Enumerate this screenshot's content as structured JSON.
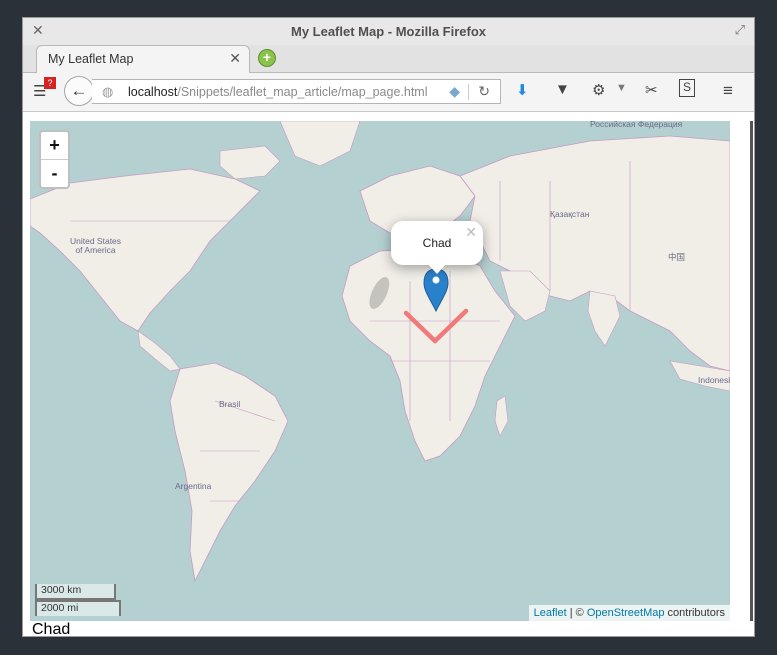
{
  "window": {
    "title": "My Leaflet Map - Mozilla Firefox"
  },
  "tab": {
    "label": "My Leaflet Map"
  },
  "urlbar": {
    "host": "localhost",
    "path": "/Snippets/leaflet_map_article/map_page.html"
  },
  "toolbar": {
    "badge": "?"
  },
  "map": {
    "zoom_in": "+",
    "zoom_out": "-",
    "popup_text": "Chad",
    "scale_km": "3000 km",
    "scale_mi": "2000 mi",
    "labels": {
      "usa": "United States\nof America",
      "brazil": "Brasil",
      "argentina": "Argentina",
      "kazakhstan": "Қазақстан",
      "china": "中国",
      "russia": "Российская Федерация",
      "indonesia": "Indonesi"
    },
    "attribution": {
      "leaflet": "Leaflet",
      "sep": " | © ",
      "osm": "OpenStreetMap",
      "suffix": " contributors"
    }
  },
  "page": {
    "caption": "Chad"
  },
  "colors": {
    "water": "#b5d0d0",
    "land": "#f1eee8",
    "border": "#c79ac4",
    "marker": "#2a81cb",
    "check": "#f07a7a"
  }
}
